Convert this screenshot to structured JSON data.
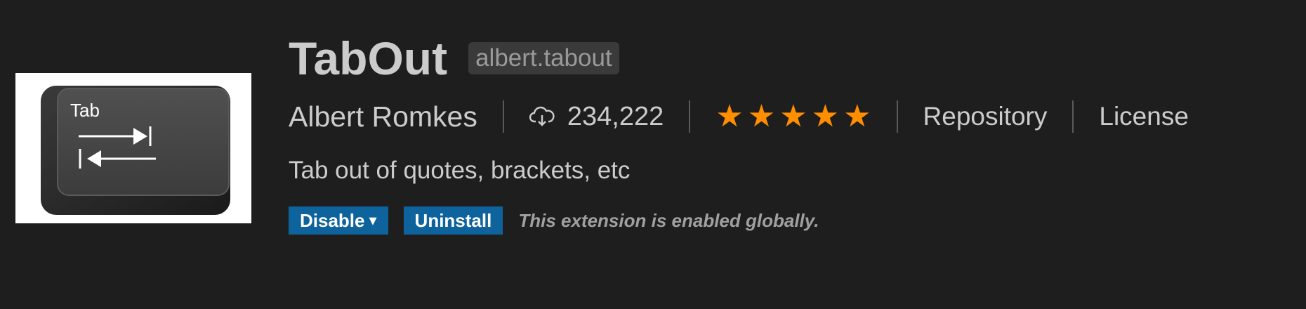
{
  "extension": {
    "title": "TabOut",
    "identifier": "albert.tabout",
    "publisher": "Albert Romkes",
    "install_count": "234,222",
    "rating": 5,
    "rating_max": 5,
    "repository_label": "Repository",
    "license_label": "License",
    "description": "Tab out of quotes, brackets, etc",
    "logo": {
      "key_label": "Tab",
      "icons": [
        "tab-right-arrow-icon",
        "tab-left-arrow-icon"
      ]
    }
  },
  "actions": {
    "disable_label": "Disable",
    "disable_caret": "▾",
    "uninstall_label": "Uninstall",
    "status_text": "This extension is enabled globally."
  },
  "icons": {
    "installs": "cloud-download-icon",
    "star": "star-icon"
  },
  "colors": {
    "background": "#1e1e1e",
    "button": "#0e639c",
    "star": "#ff8e00",
    "text": "#cccccc"
  }
}
